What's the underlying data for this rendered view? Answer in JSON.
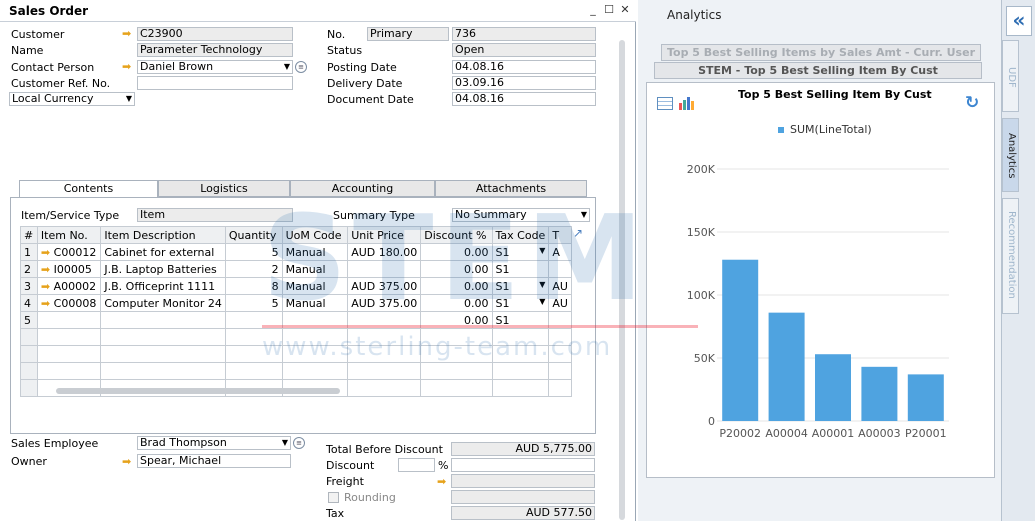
{
  "window": {
    "title": "Sales Order",
    "min": "_",
    "max": "☐",
    "close": "✕"
  },
  "header_left": {
    "customer_label": "Customer",
    "customer_value": "C23900",
    "name_label": "Name",
    "name_value": "Parameter Technology",
    "contact_label": "Contact Person",
    "contact_value": "Daniel Brown",
    "custref_label": "Customer Ref. No.",
    "custref_value": "",
    "currency_value": "Local Currency"
  },
  "header_right": {
    "no_label": "No.",
    "no_series": "Primary",
    "no_value": "736",
    "status_label": "Status",
    "status_value": "Open",
    "posting_label": "Posting Date",
    "posting_value": "04.08.16",
    "delivery_label": "Delivery Date",
    "delivery_value": "03.09.16",
    "document_label": "Document Date",
    "document_value": "04.08.16"
  },
  "tabs": [
    "Contents",
    "Logistics",
    "Accounting",
    "Attachments"
  ],
  "contents": {
    "item_type_label": "Item/Service Type",
    "item_type_value": "Item",
    "summary_label": "Summary Type",
    "summary_value": "No Summary",
    "columns": [
      "#",
      "Item No.",
      "Item Description",
      "Quantity",
      "UoM Code",
      "Unit Price",
      "Discount %",
      "Tax Code",
      "T"
    ],
    "rows": [
      {
        "n": "1",
        "item": "C00012",
        "desc": "Cabinet for external",
        "qty": "5",
        "uom": "Manual",
        "price": "AUD 180.00",
        "disc": "0.00",
        "tax": "S1",
        "t": "A"
      },
      {
        "n": "2",
        "item": "I00005",
        "desc": "J.B. Laptop Batteries",
        "qty": "2",
        "uom": "Manual",
        "price": "",
        "disc": "0.00",
        "tax": "S1",
        "t": ""
      },
      {
        "n": "3",
        "item": "A00002",
        "desc": "J.B. Officeprint 1111",
        "qty": "8",
        "uom": "Manual",
        "price": "AUD 375.00",
        "disc": "0.00",
        "tax": "S1",
        "t": "AU"
      },
      {
        "n": "4",
        "item": "C00008",
        "desc": "Computer Monitor 24",
        "qty": "5",
        "uom": "Manual",
        "price": "AUD 375.00",
        "disc": "0.00",
        "tax": "S1",
        "t": "AU"
      },
      {
        "n": "5",
        "item": "",
        "desc": "",
        "qty": "",
        "uom": "",
        "price": "",
        "disc": "0.00",
        "tax": "S1",
        "t": ""
      }
    ]
  },
  "footer_left": {
    "employee_label": "Sales Employee",
    "employee_value": "Brad Thompson",
    "owner_label": "Owner",
    "owner_value": "Spear, Michael"
  },
  "footer_right": {
    "total_before_label": "Total Before Discount",
    "total_before_value": "AUD 5,775.00",
    "discount_label": "Discount",
    "discount_pct": "%",
    "freight_label": "Freight",
    "rounding_label": "Rounding",
    "tax_label": "Tax",
    "tax_value": "AUD 577.50"
  },
  "analytics": {
    "title": "Analytics",
    "report_tab1": "Top 5 Best Selling Items by Sales Amt - Curr. User",
    "report_tab2": "STEM - Top 5 Best Selling Item By Cust",
    "chart_title": "Top 5 Best Selling Item By Cust",
    "legend": "SUM(LineTotal)"
  },
  "sidebar": {
    "tab1": "UDF",
    "tab2": "Analytics",
    "tab3": "Recommendation",
    "collapse": "«"
  },
  "watermark": {
    "big": "STEM",
    "small": "www.sterling-team.com"
  },
  "colors": {
    "bar": "#4fa3e0",
    "accent": "#e6a21b"
  },
  "chart_data": {
    "type": "bar",
    "title": "Top 5 Best Selling Item By Cust",
    "categories": [
      "P20002",
      "A00004",
      "A00001",
      "A00003",
      "P20001"
    ],
    "series": [
      {
        "name": "SUM(LineTotal)",
        "values": [
          128000,
          86000,
          53000,
          43000,
          37000
        ]
      }
    ],
    "ylim": [
      0,
      200000
    ],
    "yticks": [
      "0",
      "50K",
      "100K",
      "150K",
      "200K"
    ],
    "grid": true,
    "legend": "top"
  }
}
